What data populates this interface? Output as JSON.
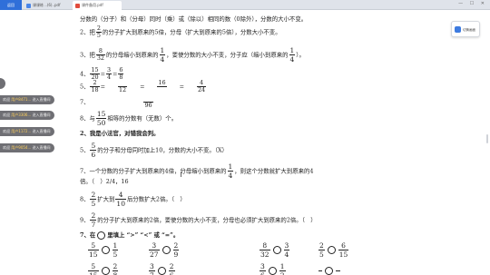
{
  "titlebar": {
    "left_label": "返回",
    "tabs": [
      {
        "label": "课课练 ..(6)..pdf"
      },
      {
        "label": "课件备用.pdf"
      }
    ],
    "controls": "— ☐ ✕"
  },
  "document": {
    "lines": {
      "l1": "分数的（分子）和（分母）同时（乘）或（除以）相同的数（0除外），分数的大小不变。",
      "l2a": "2、把",
      "l2n": "2",
      "l2d": "5",
      "l2b": "的分子扩大到原来的5倍，分母（扩大到原来的5倍），分数大小不变。",
      "l3a": "3、把",
      "l3n": "8",
      "l3d": "32",
      "l3b": "的分母缩小到原来的",
      "l3n2": "1",
      "l3d2": "4",
      "l3c": "，要使分数的大小不变，分子应（缩小到原来的",
      "l3n3": "1",
      "l3d3": "4",
      "l3e": "）。",
      "l4a": "4、",
      "l4n": "15",
      "l4d": "20",
      "l4b": "=",
      "l4n2": "3",
      "l4d2": "4",
      "l4c": "=",
      "l4n3": "6",
      "l4d3": "8",
      "l5a": "5、",
      "l5n": "2",
      "l5d": "18",
      "l5b": "=",
      "l5n2": "",
      "l5d2": "12",
      "l5c": "=",
      "l5n3": "16",
      "l5d3": "",
      "l5e": "=",
      "l5n4": "4",
      "l5d4": "24",
      "l6a": "7、",
      "l6n": "",
      "l6d": "96",
      "l7a": "8、与",
      "l7n": "15",
      "l7d": "50",
      "l7b": "相等的分数有（无数）个。",
      "h2": "2、我是小法官，对错我会判。",
      "l8a": "5、",
      "l8n": "5",
      "l8d": "6",
      "l8b": "的分子和分母同时加上10，分数的大小不变。（X）",
      "l9a": "7、一个分数的分子扩大到原来的4倍，分母缩小到原来的",
      "l9n": "1",
      "l9d": "4",
      "l9b": "，则这个分数就扩大到原来的4",
      "l10": "倍。（　）2/4，16",
      "l11a": "8、",
      "l11n": "2",
      "l11d": "5",
      "l11b": "扩大到",
      "l11n2": "4",
      "l11d2": "10",
      "l11c": "后分数扩大2倍。（　）",
      "l12a": "9、",
      "l12n": "2",
      "l12d": "7",
      "l12b": "的分子扩大到原来的2倍，要使分数的大小不变，分母也必须扩大到原来的2倍。（　）",
      "h3a": "7、在",
      "h3b": "里填上 “>” “<” 或 “=”。"
    },
    "compare": [
      {
        "n1": "5",
        "d1": "15",
        "n2": "1",
        "d2": "5"
      },
      {
        "n1": "3",
        "d1": "27",
        "n2": "2",
        "d2": "9"
      },
      {
        "n1": "8",
        "d1": "32",
        "n2": "3",
        "d2": "4"
      },
      {
        "n1": "2",
        "d1": "5",
        "n2": "6",
        "d2": "15"
      },
      {
        "n1": "5",
        "d1": "15",
        "n2": "2",
        "d2": "8"
      },
      {
        "n1": "3",
        "d1": "7",
        "n2": "2",
        "d2": "6"
      },
      {
        "n1": "3",
        "d1": "6",
        "n2": "1",
        "d2": "2"
      },
      {
        "n1": "",
        "d1": "",
        "n2": "",
        "d2": ""
      }
    ]
  },
  "toasts": [
    {
      "prefix": "欢迎",
      "name": "用户8471...",
      "suffix": "进入直播间"
    },
    {
      "prefix": "欢迎",
      "name": "用户3306...",
      "suffix": "进入直播间"
    },
    {
      "prefix": "欢迎",
      "name": "用户1172...",
      "suffix": "进入直播间"
    },
    {
      "prefix": "欢迎",
      "name": "用户9054...",
      "suffix": "进入直播间"
    }
  ],
  "side_card": {
    "label": "切换画面"
  }
}
